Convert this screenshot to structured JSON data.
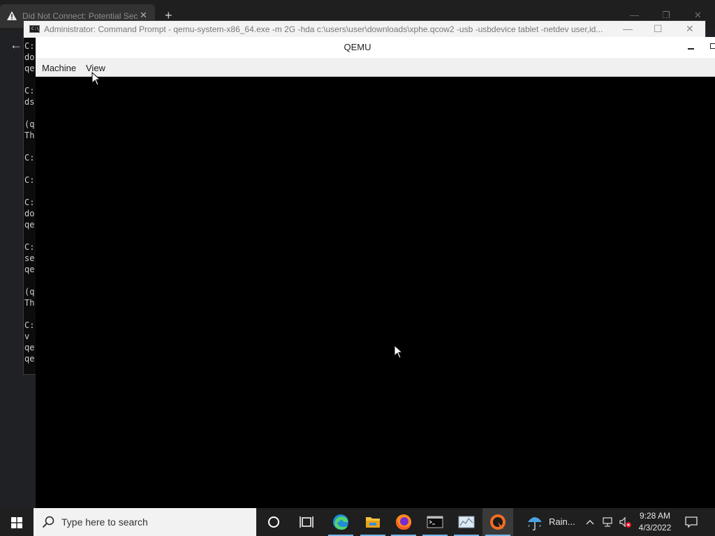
{
  "browser": {
    "tab_title": "Did Not Connect: Potential Security Issue",
    "tab_close": "✕",
    "new_tab": "+",
    "back": "←",
    "window_controls": {
      "minimize": "—",
      "restore": "❐",
      "close": "✕"
    }
  },
  "cmd": {
    "title": "Administrator: Command Prompt - qemu-system-x86_64.exe  -m 2G -hda c:\\users\\user\\downloads\\xphe.qcow2 -usb -usbdevice tablet -netdev user,id...",
    "icon_text": "C:\\_",
    "controls": {
      "minimize": "—",
      "maximize": "☐",
      "close": "✕"
    },
    "lines": [
      "C:",
      "do",
      "qe",
      "",
      "C:",
      "ds",
      "",
      "(q",
      "Th",
      "",
      "C:",
      "",
      "C:",
      "",
      "C:",
      "do",
      "qe",
      "",
      "C:",
      "se",
      "qe",
      "",
      "(q",
      "Th",
      "",
      "C:",
      "v ",
      "qe",
      "qe"
    ]
  },
  "qemu": {
    "title": "QEMU",
    "menu": [
      "Machine",
      "View"
    ]
  },
  "taskbar": {
    "search_placeholder": "Type here to search",
    "weather": "Rain...",
    "tray_chevron": "^",
    "time": "9:28 AM",
    "date": "4/3/2022",
    "accent_color": "#76b9ed"
  }
}
